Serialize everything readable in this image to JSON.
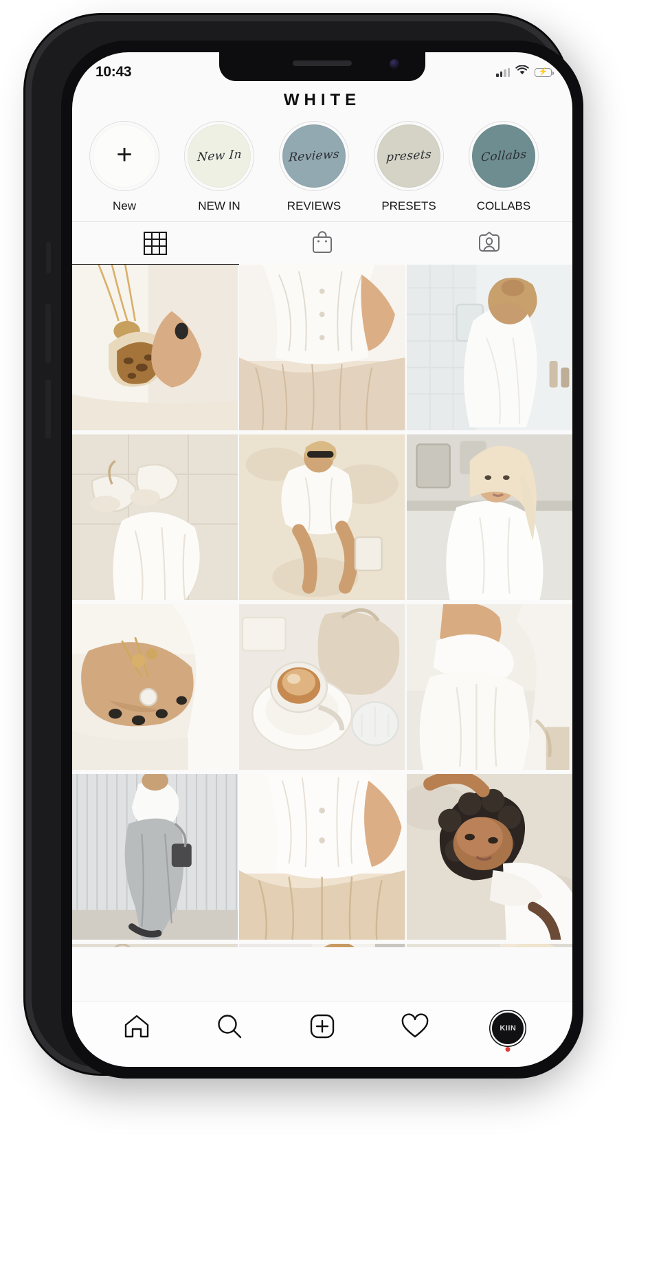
{
  "status_bar": {
    "time": "10:43",
    "signal_icon": "cellular-signal-icon",
    "wifi_icon": "wifi-icon",
    "battery_icon": "battery-charging-icon",
    "battery_level_percent": 82,
    "battery_charging": true
  },
  "profile": {
    "title": "WHITE"
  },
  "highlights": [
    {
      "label": "New",
      "script": "",
      "color": "#fcfcfb",
      "icon": "plus-icon",
      "is_add": true
    },
    {
      "label": "NEW IN",
      "script": "New In",
      "color": "#eef0e4",
      "icon": "highlight-cover-new-in",
      "is_add": false
    },
    {
      "label": "REVIEWS",
      "script": "Reviews",
      "color": "#93a9b2",
      "icon": "highlight-cover-reviews",
      "is_add": false
    },
    {
      "label": "PRESETS",
      "script": "presets",
      "color": "#d4d3c6",
      "icon": "highlight-cover-presets",
      "is_add": false
    },
    {
      "label": "COLLABS",
      "script": "Collabs",
      "color": "#6e8d91",
      "icon": "highlight-cover-collabs",
      "is_add": false
    }
  ],
  "tabs": [
    {
      "name": "grid",
      "icon": "grid-icon",
      "active": true
    },
    {
      "name": "shop",
      "icon": "shopping-bag-icon",
      "active": false
    },
    {
      "name": "tagged",
      "icon": "tagged-person-icon",
      "active": false
    }
  ],
  "grid_posts": [
    {
      "alt": "gold layered necklaces and leopard print compact mirror held in hand"
    },
    {
      "alt": "white textured button-down shirt tucked into beige pleated trousers"
    },
    {
      "alt": "blonde woman with low bun wearing white blouse in bathroom"
    },
    {
      "alt": "white sneakers and white jeans on pale stone pavement"
    },
    {
      "alt": "woman in white oversized shirt and sunglasses sitting on marble floor"
    },
    {
      "alt": "blonde woman in crisp white shirt on ornate city street"
    },
    {
      "alt": "hand with gold rings and coin necklace against white fabric"
    },
    {
      "alt": "cappuccino in glass cup beside beige handbag on marble table"
    },
    {
      "alt": "white bralette top and tailored white trousers"
    },
    {
      "alt": "woman in white crop top and wide leg grey jeans by ribbed wall"
    },
    {
      "alt": "white ribbed shirt over beige pleated skirt close-up"
    },
    {
      "alt": "curly haired woman in white top lying on sand"
    },
    {
      "alt": "white heels on textured stone ground"
    },
    {
      "alt": "woman in sunglasses and white top leaning on white wall"
    },
    {
      "alt": "platinum blonde woman portrait in front of pale building"
    }
  ],
  "bottom_nav": [
    {
      "name": "home",
      "icon": "home-icon",
      "active": true
    },
    {
      "name": "search",
      "icon": "search-icon",
      "active": false
    },
    {
      "name": "create",
      "icon": "plus-square-icon",
      "active": false
    },
    {
      "name": "activity",
      "icon": "heart-icon",
      "active": false
    },
    {
      "name": "profile",
      "icon": "avatar-icon",
      "active": false,
      "avatar_text": "KIIN",
      "has_badge": true
    }
  ],
  "colors": {
    "screen_bg": "#fafafa",
    "text_primary": "#111113",
    "divider": "#e6e6e6",
    "badge_red": "#e53935",
    "battery_green": "#30d158"
  }
}
